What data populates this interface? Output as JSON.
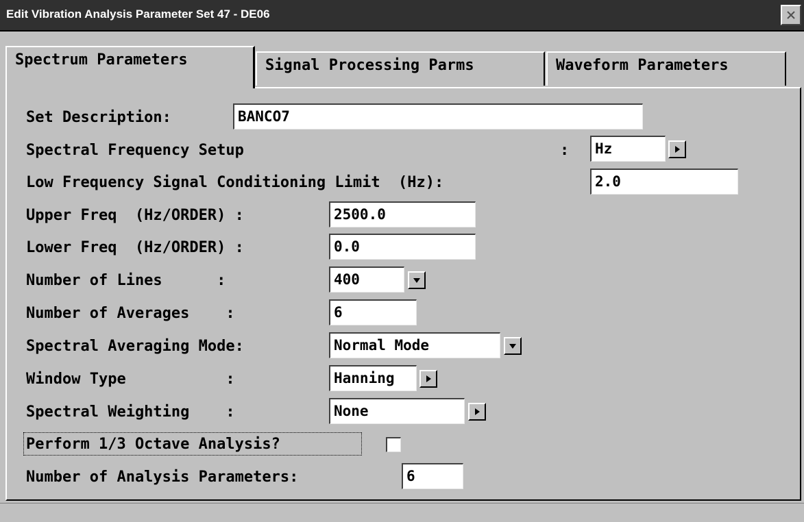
{
  "window": {
    "title": "Edit Vibration Analysis Parameter Set 47 - DE06"
  },
  "tabs": [
    {
      "label": "Spectrum Parameters",
      "active": true
    },
    {
      "label": "Signal Processing Parms",
      "active": false
    },
    {
      "label": "Waveform Parameters",
      "active": false
    }
  ],
  "form": {
    "set_description": {
      "label": "Set Description:",
      "value": "BANCO7"
    },
    "spectral_frequency_setup": {
      "label": "Spectral Frequency Setup",
      "colon": ":",
      "value": "Hz"
    },
    "low_freq_limit": {
      "label": "Low Frequency Signal Conditioning Limit  (Hz):",
      "value": "2.0"
    },
    "upper_freq": {
      "label": "Upper Freq  (Hz/ORDER) :",
      "value": "2500.0"
    },
    "lower_freq": {
      "label": "Lower Freq  (Hz/ORDER) :",
      "value": "0.0"
    },
    "number_of_lines": {
      "label": "Number of Lines      :",
      "value": "400"
    },
    "number_of_averages": {
      "label": "Number of Averages    :",
      "value": "6"
    },
    "averaging_mode": {
      "label": "Spectral Averaging Mode:",
      "value": "Normal Mode"
    },
    "window_type": {
      "label": "Window Type           :",
      "value": "Hanning"
    },
    "spectral_weighting": {
      "label": "Spectral Weighting    :",
      "value": "None"
    },
    "octave_analysis": {
      "label": "Perform 1/3 Octave Analysis?",
      "checked": false
    },
    "num_analysis_params": {
      "label": "Number of Analysis Parameters:",
      "value": "6"
    }
  },
  "colors": {
    "titlebar_bg": "#303030",
    "window_bg": "#c0c0c0",
    "field_bg": "#ffffff"
  },
  "icons": {
    "close": "close-icon",
    "arrow_right": "arrow-right-icon",
    "arrow_down": "arrow-down-icon"
  }
}
